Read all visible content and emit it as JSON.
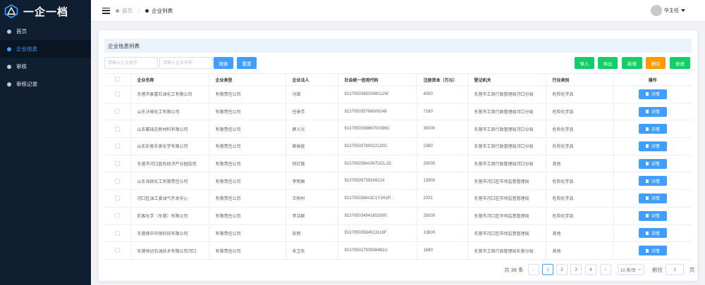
{
  "app": {
    "logo_text": "一企一档"
  },
  "sidebar": {
    "items": [
      {
        "label": "首页"
      },
      {
        "label": "企业信息"
      },
      {
        "label": "审核"
      },
      {
        "label": "审核记录"
      }
    ]
  },
  "header": {
    "breadcrumb_home": "首页",
    "breadcrumb_current": "企业列表",
    "user_name": "华主任"
  },
  "card": {
    "title": "企业信息列表",
    "type_placeholder": "请输入企业类型",
    "name_placeholder": "请输入企业名称",
    "search_label": "搜索",
    "reset_label": "重置",
    "import_label": "导入",
    "export_label": "导出",
    "add_label": "新增",
    "delete_label": "删除",
    "edit_label": "修改"
  },
  "table": {
    "columns": [
      "企业名称",
      "企业类型",
      "企业法人",
      "社会统一信用代码",
      "注册资本（万元）",
      "登记机关",
      "行业类别",
      "操作"
    ],
    "detail_label": "详情",
    "rows": [
      {
        "name": "东营市泰富石油化工有限公司",
        "type": "有限责任公司",
        "legal": "冯斌",
        "code": "913705036920480­12W",
        "capital": "4000",
        "authority": "东营市工商行政管理局河口分局",
        "industry": "危险化学品"
      },
      {
        "name": "山东沃格化工有限公司",
        "type": "有限责任公司",
        "legal": "任景芳",
        "code": "91370503576600914​6",
        "capital": "7160",
        "authority": "东营市工商行政管理局河口分局",
        "industry": "危险化学品"
      },
      {
        "name": "山东戴瑞克新材料有限公司",
        "type": "有限责任公司",
        "legal": "薛义光",
        "code": "913705035866700399C",
        "capital": "30000",
        "authority": "东营市工商行政管理局河口分局",
        "industry": "危险化学品"
      },
      {
        "name": "山东彩客东奥化学有限公司",
        "type": "有限责任公司",
        "legal": "崔振庭",
        "code": "91370503780022130C",
        "capital": "2380",
        "authority": "东营市工商行政管理局河口分局",
        "industry": "危险化学品"
      },
      {
        "name": "东营市河口蓝色经济产业园投资",
        "type": "有限责任公司",
        "legal": "徐红敬",
        "code": "91370503MA3N7UCL1D",
        "capital": "20000",
        "authority": "东营市工商行政管理局河口分局",
        "industry": "其他"
      },
      {
        "name": "山东海跃化工有限责任公司",
        "type": "有限责任公司",
        "legal": "李明国",
        "code": "91370505739249214",
        "capital": "13900",
        "authority": "东营市河口区市场监督管理局",
        "industry": "危险化学品"
      },
      {
        "name": "河口区油工委油气开发中心",
        "type": "有限责任公司",
        "legal": "王树村",
        "code": "91370503MA3C1YJH1R",
        "capital": "2031",
        "authority": "东营市河口区市场监督管理局",
        "industry": "危险化学品"
      },
      {
        "name": "彩客化学（东营）有限公司",
        "type": "有限责任公司",
        "legal": "李洁群",
        "code": "913705034941652000",
        "capital": "25000",
        "authority": "东营市河口区市场监督管理局",
        "industry": "危险化学品"
      },
      {
        "name": "东营德中环保科技有限公司",
        "type": "有限责任公司",
        "legal": "张明",
        "code": "91370503584513116F",
        "capital": "13800",
        "authority": "东营市河口区市场监督管理局",
        "industry": "其他"
      },
      {
        "name": "东营恒达石油技术有限公司河口",
        "type": "有限责任公司",
        "legal": "朱卫东",
        "code": "9137050279393848​1U",
        "capital": "1680",
        "authority": "东营市工商行政管理局东营分局",
        "industry": "其他"
      }
    ]
  },
  "pagination": {
    "total_text": "共 38 条",
    "prev": "‹",
    "pages": [
      "1",
      "2",
      "3",
      "4"
    ],
    "next": "›",
    "page_size": "10 条/页",
    "goto_label": "前往",
    "goto_value": "1",
    "goto_unit": "页"
  },
  "colors": {
    "sidebar_bg": "#0f1e31",
    "primary": "#409eff",
    "success": "#13ce66",
    "warning": "#ff9900"
  }
}
